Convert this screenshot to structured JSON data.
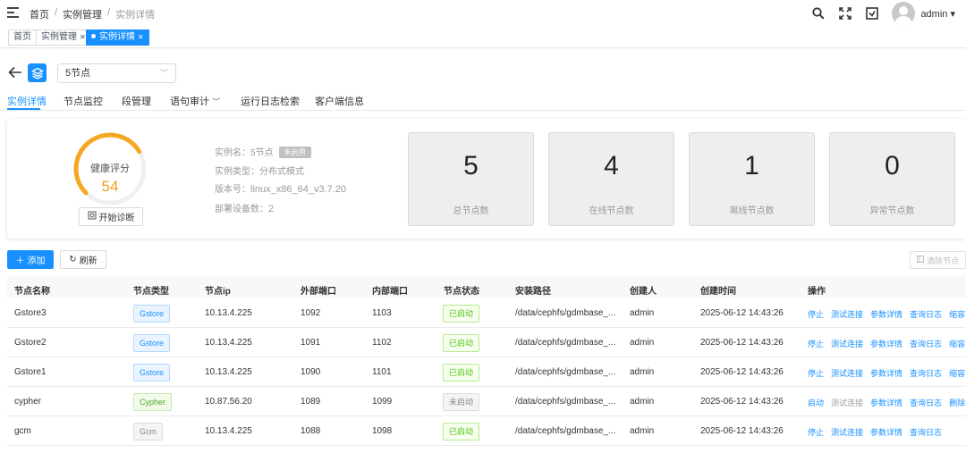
{
  "breadcrumb": {
    "home": "首页",
    "parent": "实例管理",
    "current": "实例详情"
  },
  "user": {
    "name": "admin"
  },
  "tags": [
    {
      "label": "首页"
    },
    {
      "label": "实例管理"
    },
    {
      "label": "实例详情"
    }
  ],
  "instance_select": {
    "value": "5节点"
  },
  "subtabs": [
    "实例详情",
    "节点监控",
    "段管理",
    "语句审计",
    "运行日志检索",
    "客户端信息"
  ],
  "health": {
    "label": "健康评分",
    "score": "54",
    "fraction": 0.54,
    "diagnose_label": "开始诊断"
  },
  "info": {
    "name_label": "实例名：",
    "name_value": "5节点",
    "name_badge": "未启用",
    "type_label": "实例类型：",
    "type_value": "分布式模式",
    "version_label": "版本号：",
    "version_value": "linux_x86_64_v3.7.20",
    "devices_label": "部署设备数：",
    "devices_value": "2"
  },
  "stats": [
    {
      "value": "5",
      "label": "总节点数"
    },
    {
      "value": "4",
      "label": "在线节点数"
    },
    {
      "value": "1",
      "label": "离线节点数"
    },
    {
      "value": "0",
      "label": "异常节点数"
    }
  ],
  "actions": {
    "add": "添加",
    "refresh": "刷新",
    "clear": "清除节点"
  },
  "table": {
    "headers": [
      "节点名称",
      "节点类型",
      "节点ip",
      "外部端口",
      "内部端口",
      "节点状态",
      "安装路径",
      "创建人",
      "创建时间",
      "操作"
    ],
    "rows": [
      {
        "name": "Gstore3",
        "type": "Gstore",
        "type_style": "blue",
        "ip": "10.13.4.225",
        "ext": "1092",
        "int": "1103",
        "status": "已启动",
        "status_style": "on",
        "path": "/data/cephfs/gdmbase_...",
        "creator": "admin",
        "created": "2025-06-12 14:43:26",
        "ops": [
          "停止",
          "测试连接",
          "参数详情",
          "查询日志",
          "缩容"
        ]
      },
      {
        "name": "Gstore2",
        "type": "Gstore",
        "type_style": "blue",
        "ip": "10.13.4.225",
        "ext": "1091",
        "int": "1102",
        "status": "已启动",
        "status_style": "on",
        "path": "/data/cephfs/gdmbase_...",
        "creator": "admin",
        "created": "2025-06-12 14:43:26",
        "ops": [
          "停止",
          "测试连接",
          "参数详情",
          "查询日志",
          "缩容"
        ]
      },
      {
        "name": "Gstore1",
        "type": "Gstore",
        "type_style": "blue",
        "ip": "10.13.4.225",
        "ext": "1090",
        "int": "1101",
        "status": "已启动",
        "status_style": "on",
        "path": "/data/cephfs/gdmbase_...",
        "creator": "admin",
        "created": "2025-06-12 14:43:26",
        "ops": [
          "停止",
          "测试连接",
          "参数详情",
          "查询日志",
          "缩容"
        ]
      },
      {
        "name": "cypher",
        "type": "Cypher",
        "type_style": "green",
        "ip": "10.87.56.20",
        "ext": "1089",
        "int": "1099",
        "status": "未启动",
        "status_style": "off",
        "path": "/data/cephfs/gdmbase_...",
        "creator": "admin",
        "created": "2025-06-12 14:43:26",
        "ops": [
          "启动",
          "测试连接",
          "参数详情",
          "查询日志",
          "删除"
        ]
      },
      {
        "name": "gcm",
        "type": "Gcm",
        "type_style": "grey",
        "ip": "10.13.4.225",
        "ext": "1088",
        "int": "1098",
        "status": "已启动",
        "status_style": "on",
        "path": "/data/cephfs/gdmbase_...",
        "creator": "admin",
        "created": "2025-06-12 14:43:26",
        "ops": [
          "停止",
          "测试连接",
          "参数详情",
          "查询日志"
        ]
      }
    ]
  }
}
